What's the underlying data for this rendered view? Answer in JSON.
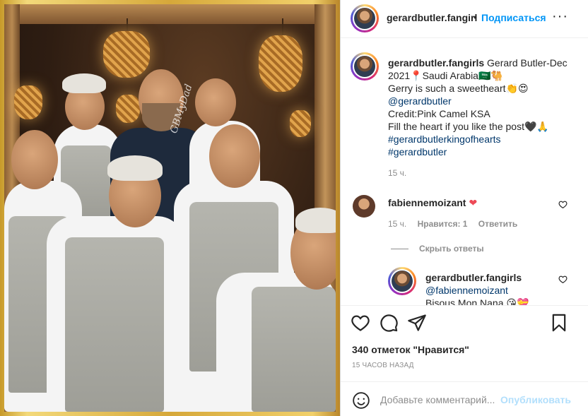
{
  "post": {
    "image_alt": "Photo of smiling staff in aprons posing with a man in a navy shirt",
    "image_watermark": "GBMyDad"
  },
  "header": {
    "username": "gerardbutler.fangirl",
    "separator": "•",
    "follow_label": "Подписаться",
    "more_icon": "more-horizontal-icon",
    "more_glyph": "···"
  },
  "caption": {
    "username": "gerardbutler.fangirls",
    "lines": [
      "Gerard Butler-Dec",
      "2021📍Saudi Arabia🇸🇦🐫",
      "Gerry is such a sweetheart👏😍"
    ],
    "mention": "@gerardbutler",
    "credit": "Credit:Pink Camel KSA",
    "fill_heart": "Fill the heart if you like the post🖤🙏",
    "hashtags": [
      "#gerardbutlerkingofhearts",
      "#gerardbutler"
    ],
    "time": "15 ч."
  },
  "comment": {
    "username": "fabiennemoizant",
    "heart": "❤",
    "time": "15 ч.",
    "likes": "Нравится: 1",
    "reply_label": "Ответить",
    "view_replies": "Скрыть ответы"
  },
  "reply": {
    "username": "gerardbutler.fangirls",
    "mention": "@fabiennemoizant",
    "text": "Bisous Mon Nana 😘💝"
  },
  "actions": {
    "likes_label": "340 отметок \"Нравится\"",
    "date_label": "15 ЧАСОВ НАЗАД"
  },
  "add_comment": {
    "placeholder": "Добавьте комментарий...",
    "publish_label": "Опубликовать"
  },
  "colors": {
    "accent": "#0095f6",
    "link": "#00376b",
    "muted": "#8e8e8e",
    "heart_red": "#ed4956",
    "publish_disabled": "#b2dffc"
  }
}
